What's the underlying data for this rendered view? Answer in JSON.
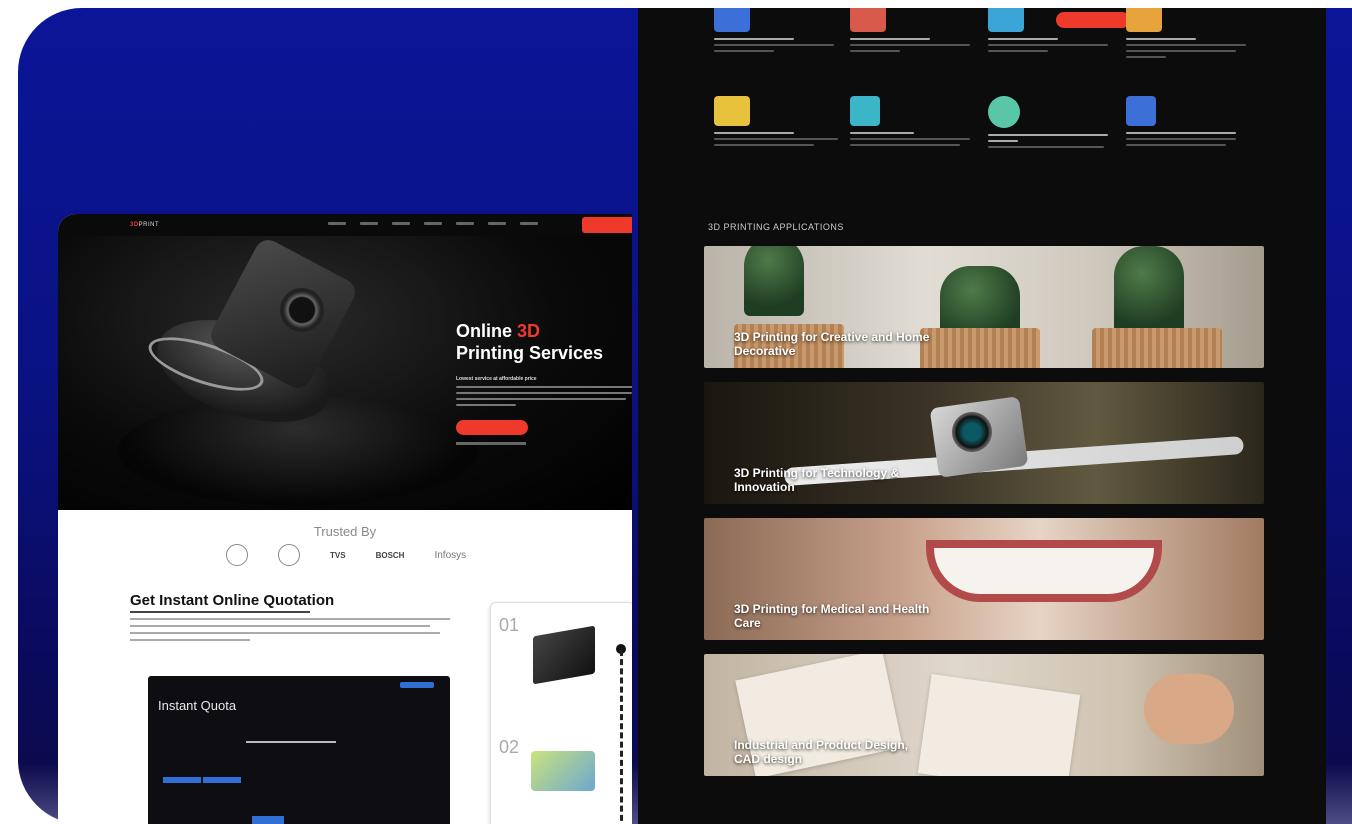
{
  "left": {
    "nav": {
      "logo_prefix": "3D",
      "logo_suffix": "PRINT"
    },
    "hero": {
      "title_prefix": "Online ",
      "title_accent": "3D",
      "title_line2": "Printing Services",
      "subtitle": "Lowest service at affordable price"
    },
    "trusted_label": "Trusted By",
    "brands": [
      "TVS",
      "BOSCH",
      "Infosys"
    ],
    "quote": {
      "title": "Get Instant Online Quotation",
      "panel_title": "Instant Quota"
    },
    "steps": [
      "01",
      "02"
    ]
  },
  "right": {
    "features": [
      {
        "title": "",
        "icon": "desktop-icon",
        "color": "#3c6fd8"
      },
      {
        "title": "",
        "icon": "hands-icon",
        "color": "#d85a4a"
      },
      {
        "title": "",
        "icon": "support-icon",
        "color": "#3aa5d6"
      },
      {
        "title": "",
        "icon": "rocket-icon",
        "color": "#e8a43c"
      },
      {
        "title": "",
        "icon": "folder-icon",
        "color": "#e8c23c"
      },
      {
        "title": "",
        "icon": "quality-icon",
        "color": "#3ab6c8"
      },
      {
        "title": "",
        "icon": "globe-icon",
        "color": "#5ac6a8"
      },
      {
        "title": "",
        "icon": "laptop-icon",
        "color": "#3c6fd8"
      }
    ],
    "applications_label": "3D PRINTING APPLICATIONS",
    "applications": [
      "3D Printing for Creative and Home Decorative",
      "3D Printing for Technology & Innovation",
      "3D Printing for Medical and Health Care",
      "Industrial and Product Design, CAD design"
    ]
  },
  "colors": {
    "accent": "#ef3a2b",
    "bg_gradient_top": "#0b1597",
    "dark_panel": "#0c0c0c"
  }
}
